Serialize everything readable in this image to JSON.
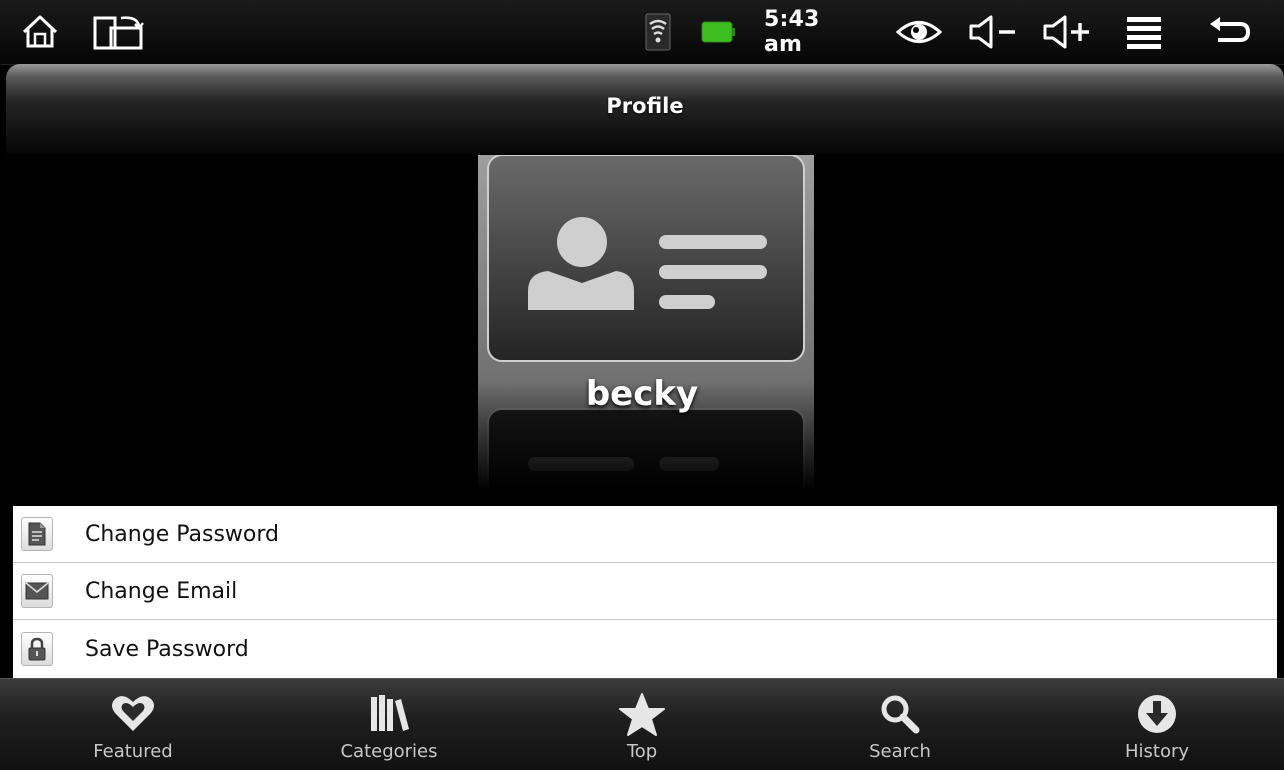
{
  "status_bar": {
    "time": "5:43 am",
    "icons": [
      "home-icon",
      "rotate-screen-icon",
      "wifi-icon",
      "battery-icon",
      "eye-icon",
      "volume-down-icon",
      "volume-up-icon",
      "menu-icon",
      "back-icon"
    ]
  },
  "header": {
    "title": "Profile"
  },
  "profile": {
    "username": "becky"
  },
  "options": [
    {
      "label": "Change Password",
      "icon": "document-icon"
    },
    {
      "label": "Change Email",
      "icon": "envelope-icon"
    },
    {
      "label": "Save Password",
      "icon": "lock-icon"
    }
  ],
  "bottom_nav": [
    {
      "label": "Featured",
      "icon": "heart-icon"
    },
    {
      "label": "Categories",
      "icon": "books-icon"
    },
    {
      "label": "Top",
      "icon": "star-icon"
    },
    {
      "label": "Search",
      "icon": "search-icon"
    },
    {
      "label": "History",
      "icon": "download-icon"
    }
  ],
  "colors": {
    "battery": "#3fbf1f",
    "list_background": "#ffffff",
    "nav_label": "#c8c8c8"
  }
}
